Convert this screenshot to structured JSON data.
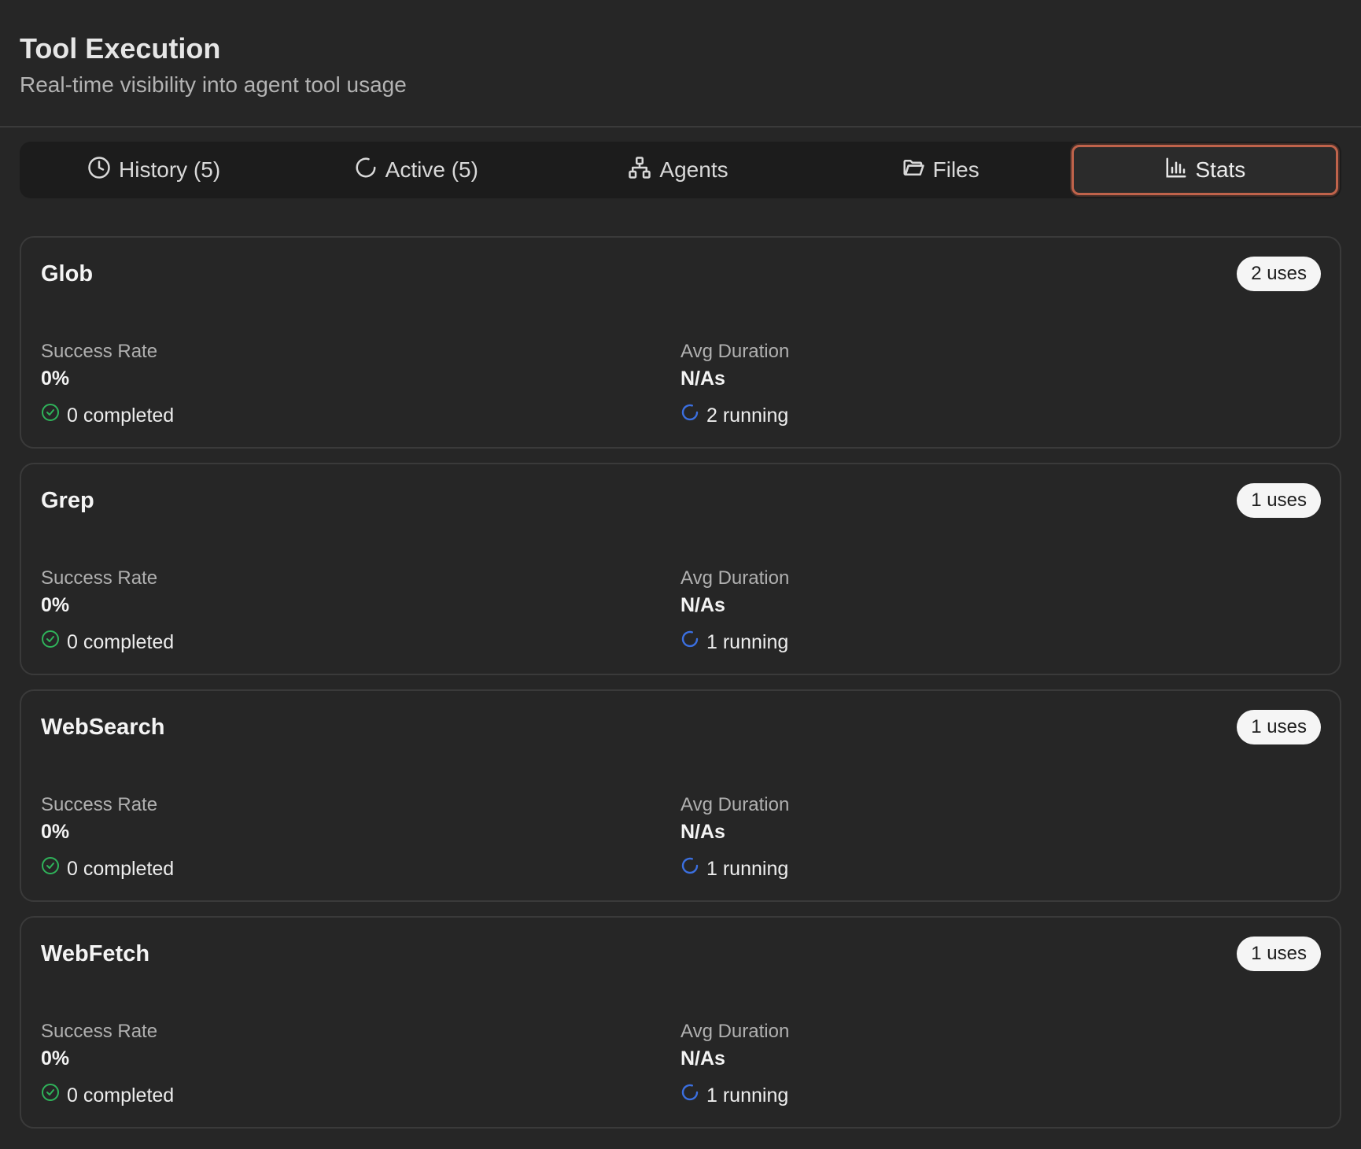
{
  "header": {
    "title": "Tool Execution",
    "subtitle": "Real-time visibility into agent tool usage"
  },
  "tabs": [
    {
      "label": "History (5)",
      "icon": "clock-icon"
    },
    {
      "label": "Active (5)",
      "icon": "spinner-icon"
    },
    {
      "label": "Agents",
      "icon": "network-icon"
    },
    {
      "label": "Files",
      "icon": "folder-icon"
    },
    {
      "label": "Stats",
      "icon": "bar-chart-icon",
      "active": true
    }
  ],
  "labels": {
    "success_rate": "Success Rate",
    "avg_duration": "Avg Duration"
  },
  "colors": {
    "accent_active_tab": "#c0634b",
    "success_green": "#2fb35a",
    "running_blue": "#3b6fe0"
  },
  "tools": [
    {
      "name": "Glob",
      "uses": "2 uses",
      "success_rate": "0%",
      "avg_duration": "N/As",
      "completed": "0 completed",
      "running": "2 running"
    },
    {
      "name": "Grep",
      "uses": "1 uses",
      "success_rate": "0%",
      "avg_duration": "N/As",
      "completed": "0 completed",
      "running": "1 running"
    },
    {
      "name": "WebSearch",
      "uses": "1 uses",
      "success_rate": "0%",
      "avg_duration": "N/As",
      "completed": "0 completed",
      "running": "1 running"
    },
    {
      "name": "WebFetch",
      "uses": "1 uses",
      "success_rate": "0%",
      "avg_duration": "N/As",
      "completed": "0 completed",
      "running": "1 running"
    }
  ]
}
